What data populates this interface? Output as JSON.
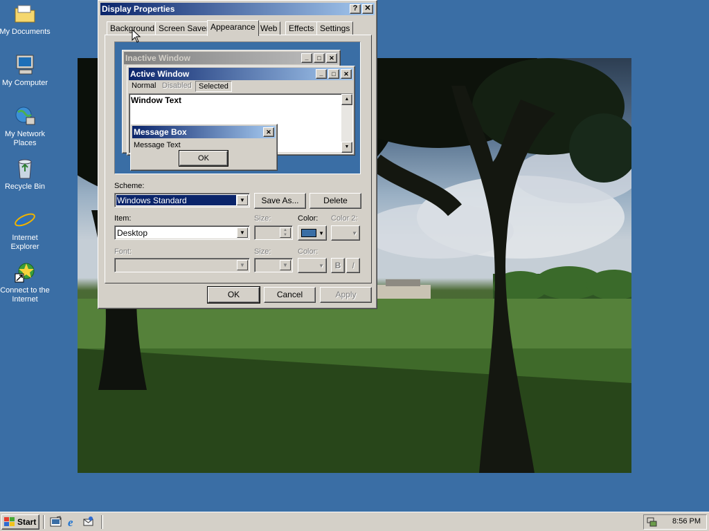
{
  "desktop": {
    "icons": [
      {
        "label": "My Documents"
      },
      {
        "label": "My Computer"
      },
      {
        "label": "My Network Places"
      },
      {
        "label": "Recycle Bin"
      },
      {
        "label": "Internet Explorer"
      },
      {
        "label": "Connect to the Internet"
      }
    ]
  },
  "dialog": {
    "title": "Display Properties",
    "help": "?",
    "close": "✕",
    "tabs": [
      "Background",
      "Screen Saver",
      "Appearance",
      "Web",
      "Effects",
      "Settings"
    ],
    "active_tab": "Appearance",
    "preview": {
      "inactive_title": "Inactive Window",
      "active_title": "Active Window",
      "menu": [
        "Normal",
        "Disabled",
        "Selected"
      ],
      "window_text": "Window Text",
      "msgbox_title": "Message Box",
      "msgbox_text": "Message Text",
      "msgbox_ok": "OK"
    },
    "scheme_label": "Scheme:",
    "scheme_value": "Windows Standard",
    "save_as": "Save As...",
    "delete": "Delete",
    "item_label": "Item:",
    "item_value": "Desktop",
    "size_label": "Size:",
    "color_label": "Color:",
    "color2_label": "Color 2:",
    "font_label": "Font:",
    "font_size_label": "Size:",
    "font_color_label": "Color:",
    "bold": "B",
    "italic": "I",
    "ok": "OK",
    "cancel": "Cancel",
    "apply": "Apply",
    "desktop_color": "#3a6ea5"
  },
  "taskbar": {
    "start": "Start",
    "clock": "8:56 PM"
  }
}
